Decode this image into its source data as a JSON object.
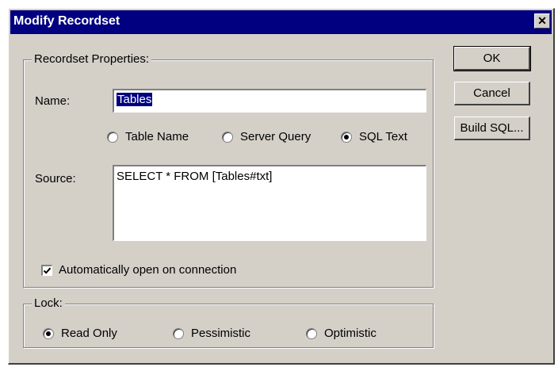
{
  "window": {
    "title": "Modify Recordset",
    "close_glyph": "✕"
  },
  "recordset_group": {
    "label": "Recordset Properties:",
    "name_label": "Name:",
    "name_value": "Tables",
    "source_type_options": [
      {
        "label": "Table Name",
        "selected": false
      },
      {
        "label": "Server Query",
        "selected": false
      },
      {
        "label": "SQL Text",
        "selected": true
      }
    ],
    "source_label": "Source:",
    "source_value": "SELECT * FROM [Tables#txt]",
    "auto_open_label": "Automatically open on connection",
    "auto_open_checked": true
  },
  "lock_group": {
    "label": "Lock:",
    "options": [
      {
        "label": "Read Only",
        "selected": true
      },
      {
        "label": "Pessimistic",
        "selected": false
      },
      {
        "label": "Optimistic",
        "selected": false
      }
    ]
  },
  "buttons": {
    "ok": "OK",
    "cancel": "Cancel",
    "build_sql": "Build SQL..."
  },
  "icons": {
    "close": "close-icon",
    "check": "checkmark-icon"
  },
  "colors": {
    "title_bar": "#000080",
    "dialog_face": "#d4d0c8",
    "selection": "#000080"
  }
}
